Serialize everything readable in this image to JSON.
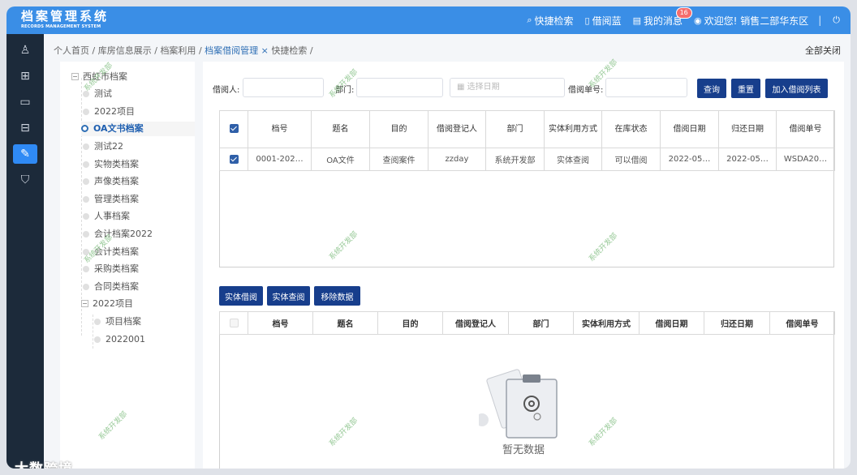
{
  "app": {
    "title_zh": "档案管理系统",
    "title_en": "RECORDS MANAGEMENT SYSTEM"
  },
  "topnav": {
    "quick_search": "快捷检索",
    "borrow_basket": "借阅蓝",
    "my_messages": "我的消息",
    "message_count": "16",
    "welcome": "欢迎您! 销售二部华东区",
    "divider": "|"
  },
  "sidebar_icons": [
    "user-icon",
    "grid-icon",
    "folder-icon",
    "inbox-icon",
    "doc-edit-icon",
    "shield-icon"
  ],
  "breadcrumb": {
    "items": [
      "个人首页",
      "库房信息展示",
      "档案利用"
    ],
    "current": "档案借阅管理",
    "close": "×",
    "next": "快捷检索",
    "sep": "/"
  },
  "close_all": "全部关闭",
  "tree": {
    "root": "西虹市档案",
    "items": [
      "测试",
      "2022项目",
      "OA文书档案",
      "测试22",
      "实物类档案",
      "声像类档案",
      "管理类档案",
      "人事档案",
      "会计档案2022",
      "会计类档案",
      "采购类档案",
      "合同类档案"
    ],
    "group": "2022项目",
    "children": [
      "项目档案",
      "2022001"
    ],
    "selected_index": 2
  },
  "filters": {
    "borrower_label": "借阅人:",
    "dept_label": "部门:",
    "date_placeholder": "选择日期",
    "order_label": "借阅单号:",
    "query": "查询",
    "reset": "重置",
    "add_list": "加入借阅列表"
  },
  "table1": {
    "headers": [
      "档号",
      "题名",
      "目的",
      "借阅登记人",
      "部门",
      "实体利用方式",
      "在库状态",
      "借阅日期",
      "归还日期",
      "借阅单号"
    ],
    "rows": [
      [
        "0001-202…",
        "OA文件",
        "查阅案件",
        "zzday",
        "系统开发部",
        "实体查阅",
        "可以借阅",
        "2022-05…",
        "2022-05…",
        "WSDA20…"
      ]
    ]
  },
  "actions": {
    "physical_borrow": "实体借阅",
    "physical_view": "实体查阅",
    "remove": "移除数据"
  },
  "table2": {
    "headers": [
      "档号",
      "题名",
      "目的",
      "借阅登记人",
      "部门",
      "实体利用方式",
      "借阅日期",
      "归还日期",
      "借阅单号"
    ],
    "empty_text": "暂无数据"
  },
  "watermark": "系统开发部",
  "brand_overlay": "大数跨境",
  "colors": {
    "topbar": "#3a8ee6",
    "sidebar": "#1c2a3a",
    "button": "#173e8c",
    "active": "#2f8af5"
  }
}
